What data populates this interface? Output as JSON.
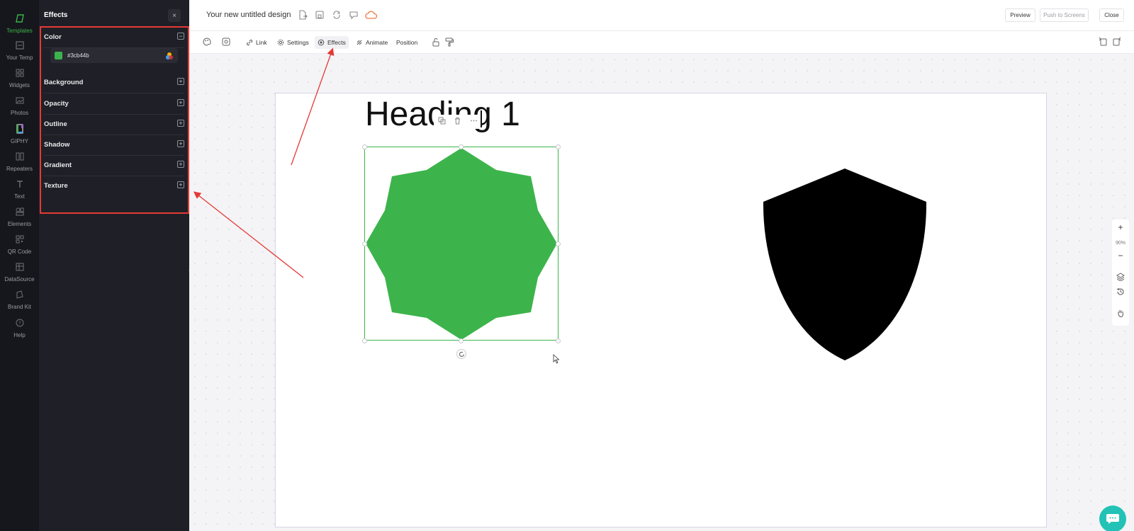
{
  "rail": {
    "items": [
      {
        "label": "Templates",
        "icon": "templates-icon",
        "active": true
      },
      {
        "label": "Your Temp",
        "icon": "your-templates-icon"
      },
      {
        "label": "Widgets",
        "icon": "widgets-icon"
      },
      {
        "label": "Photos",
        "icon": "photos-icon"
      },
      {
        "label": "GIPHY",
        "icon": "giphy-icon"
      },
      {
        "label": "Repeaters",
        "icon": "repeaters-icon"
      },
      {
        "label": "Text",
        "icon": "text-icon"
      },
      {
        "label": "Elements",
        "icon": "elements-icon"
      },
      {
        "label": "QR Code",
        "icon": "qr-code-icon"
      },
      {
        "label": "DataSource",
        "icon": "datasource-icon"
      },
      {
        "label": "Brand Kit",
        "icon": "brand-kit-icon"
      },
      {
        "label": "Help",
        "icon": "help-icon"
      }
    ]
  },
  "panel": {
    "title": "Effects",
    "close_label": "×",
    "color": {
      "label": "Color",
      "toggle": "−",
      "hex": "#3cb44b",
      "swatch": "#3cb44b"
    },
    "sections": [
      {
        "label": "Background",
        "toggle": "+"
      },
      {
        "label": "Opacity",
        "toggle": "+"
      },
      {
        "label": "Outline",
        "toggle": "+"
      },
      {
        "label": "Shadow",
        "toggle": "+"
      },
      {
        "label": "Gradient",
        "toggle": "+"
      },
      {
        "label": "Texture",
        "toggle": "+"
      }
    ]
  },
  "topbar": {
    "title": "Your new untitled design",
    "preview_label": "Preview",
    "push_label": "Push to Screens",
    "close_label": "Close"
  },
  "toolbar": {
    "link_label": "Link",
    "settings_label": "Settings",
    "effects_label": "Effects",
    "animate_label": "Animate",
    "position_label": "Position"
  },
  "canvas": {
    "heading_text": "Heading 1",
    "octagram_color": "#3cb44b",
    "shield_color": "#000000"
  },
  "zoom": {
    "plus": "+",
    "value": "90%",
    "minus": "−"
  },
  "colors": {
    "accent": "#3cb44b",
    "annotation": "#e53935",
    "panel_bg": "#1f2027",
    "rail_bg": "#16171c",
    "chat": "#22c2b6"
  }
}
